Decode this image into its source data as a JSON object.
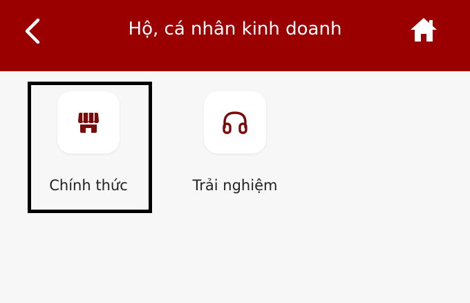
{
  "header": {
    "title": "Hộ, cá nhân kinh doanh",
    "back_icon": "chevron-left-icon",
    "home_icon": "home-icon",
    "background_color": "#9b0000"
  },
  "options": [
    {
      "label": "Chính thức",
      "icon": "store-icon",
      "selected": true
    },
    {
      "label": "Trải nghiệm",
      "icon": "headphones-icon",
      "selected": false
    }
  ],
  "colors": {
    "accent": "#9b0000",
    "icon": "#7a0a0a",
    "page_background": "#f7f7f7"
  }
}
